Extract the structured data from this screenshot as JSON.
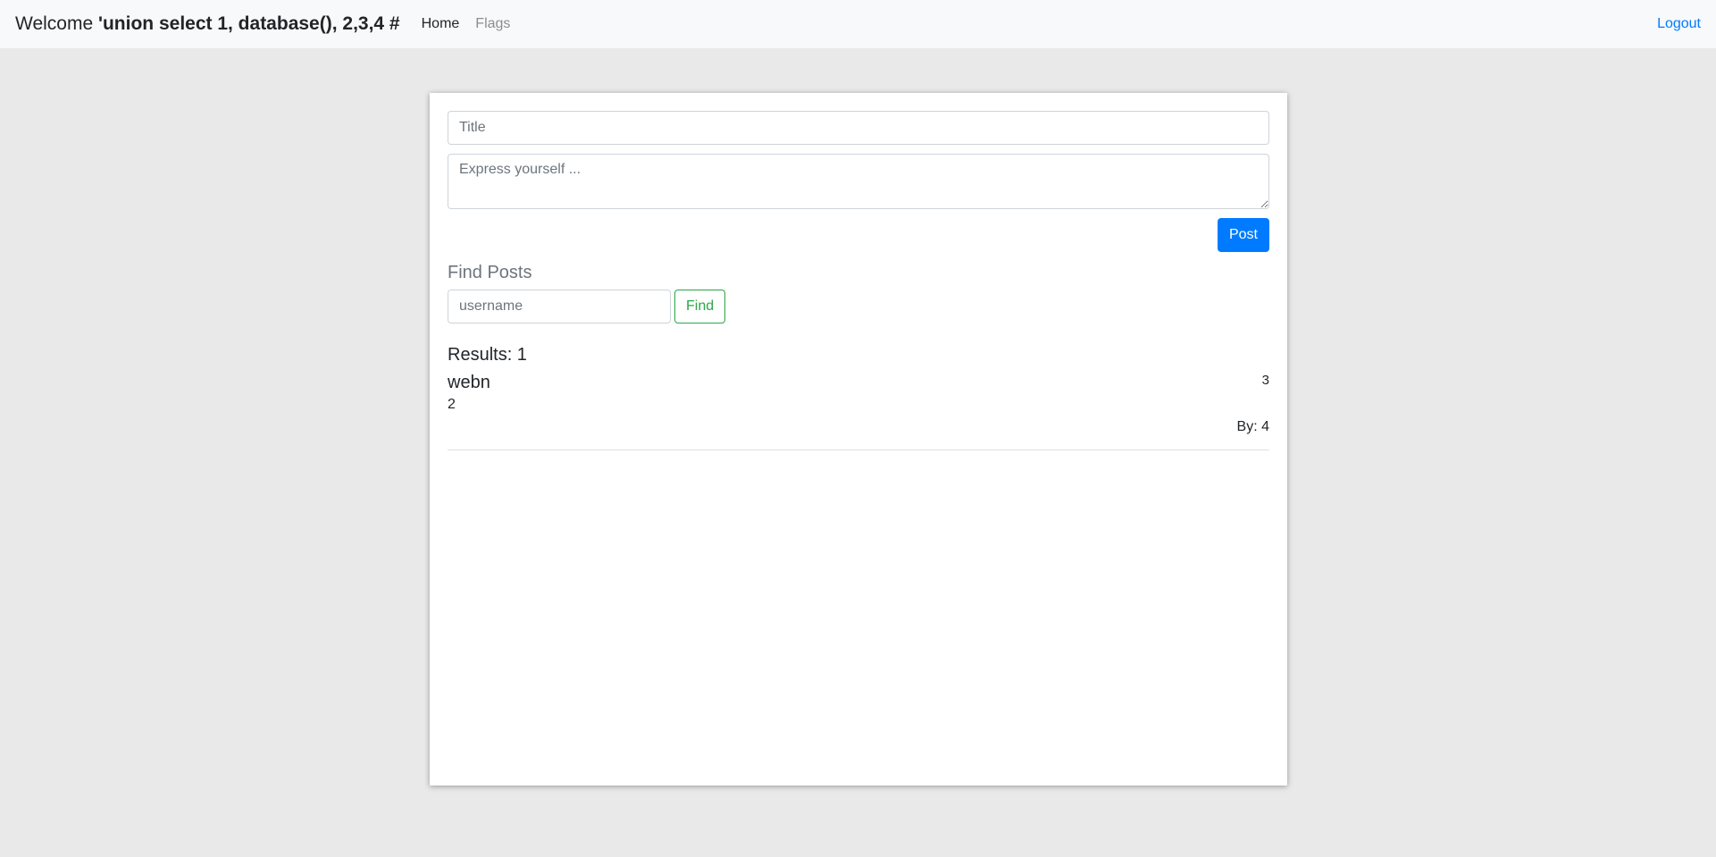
{
  "navbar": {
    "welcome_prefix": "Welcome ",
    "username": "'union select 1, database(), 2,3,4 #",
    "links": [
      {
        "label": "Home"
      },
      {
        "label": "Flags"
      }
    ],
    "logout_label": "Logout"
  },
  "composer": {
    "title_placeholder": "Title",
    "title_value": "",
    "body_placeholder": "Express yourself ...",
    "body_value": "",
    "post_button": "Post"
  },
  "search": {
    "heading": "Find Posts",
    "username_placeholder": "username",
    "username_value": "",
    "find_button": "Find"
  },
  "results": {
    "heading": "Results: 1",
    "posts": [
      {
        "title": "webn",
        "date": "3",
        "body": "2",
        "author": "By: 4"
      }
    ]
  },
  "colors": {
    "primary": "#007bff",
    "success": "#28a745",
    "navbar_bg": "#f8f9fa",
    "page_bg": "#e9e9e9"
  }
}
